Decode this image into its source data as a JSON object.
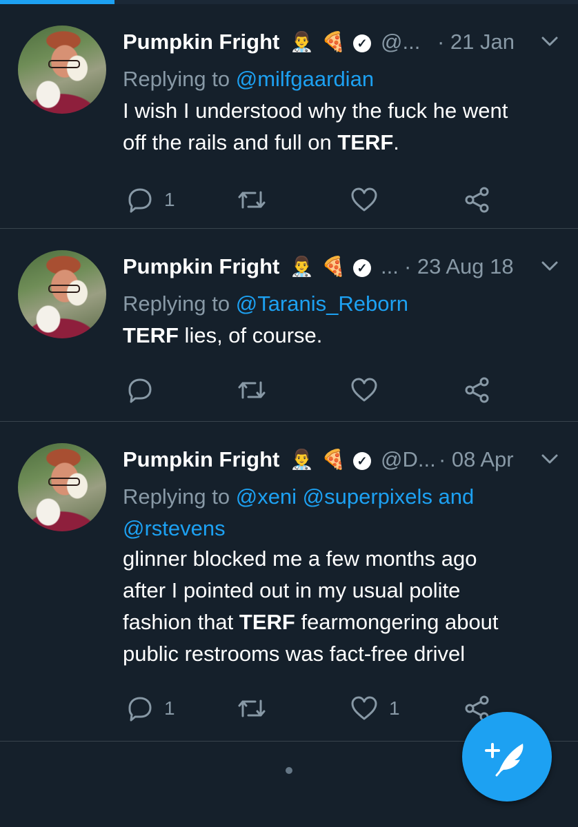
{
  "progress_fraction": 0.198,
  "tweets": [
    {
      "display_name": "Pumpkin Fright",
      "emojis": [
        "👨‍⚕️",
        "🍕"
      ],
      "handle": "@...",
      "date": "· 21 Jan",
      "replying_to_prefix": "Replying to",
      "mentions": "@milfgaardian",
      "mentions_line2": "",
      "body": [
        {
          "text": "I wish I understood why the fuck he went",
          "bold": false
        },
        {
          "text": "off the rails and full on ",
          "bold": false
        },
        {
          "text": "TERF",
          "bold": true
        },
        {
          "text": ".",
          "bold": false
        }
      ],
      "reply_count": "1",
      "retweet_count": "",
      "like_count": ""
    },
    {
      "display_name": "Pumpkin Fright",
      "emojis": [
        "👨‍⚕️",
        "🍕"
      ],
      "handle": "...",
      "date": "· 23 Aug 18",
      "replying_to_prefix": "Replying to",
      "mentions": "@Taranis_Reborn",
      "mentions_line2": "",
      "body": [
        {
          "text": "TERF",
          "bold": true
        },
        {
          "text": " lies, of course.",
          "bold": false
        }
      ],
      "reply_count": "",
      "retweet_count": "",
      "like_count": ""
    },
    {
      "display_name": "Pumpkin Fright",
      "emojis": [
        "👨‍⚕️",
        "🍕"
      ],
      "handle": "@D...",
      "date": "· 08 Apr",
      "replying_to_prefix": "Replying to",
      "mentions": "@xeni @superpixels and",
      "mentions_line2": "@rstevens",
      "body": [
        {
          "text": "glinner blocked me a few months ago",
          "bold": false
        },
        {
          "text": "after I pointed out in my usual polite",
          "bold": false
        },
        {
          "text": "fashion that ",
          "bold": false
        },
        {
          "text": "TERF",
          "bold": true
        },
        {
          "text": " fearmongering about",
          "bold": false
        },
        {
          "text": "public restrooms was fact-free drivel",
          "bold": false
        }
      ],
      "reply_count": "1",
      "retweet_count": "",
      "like_count": "1"
    }
  ],
  "icons": {
    "reply": "reply-icon",
    "retweet": "retweet-icon",
    "like": "heart-icon",
    "share": "share-icon",
    "compose": "compose-tweet-icon",
    "caret": "chevron-down-icon",
    "verified": "verified-badge-icon"
  },
  "colors": {
    "background": "#15202b",
    "accent": "#1da1f2",
    "secondary_text": "#8899a6",
    "divider": "#38444d"
  }
}
